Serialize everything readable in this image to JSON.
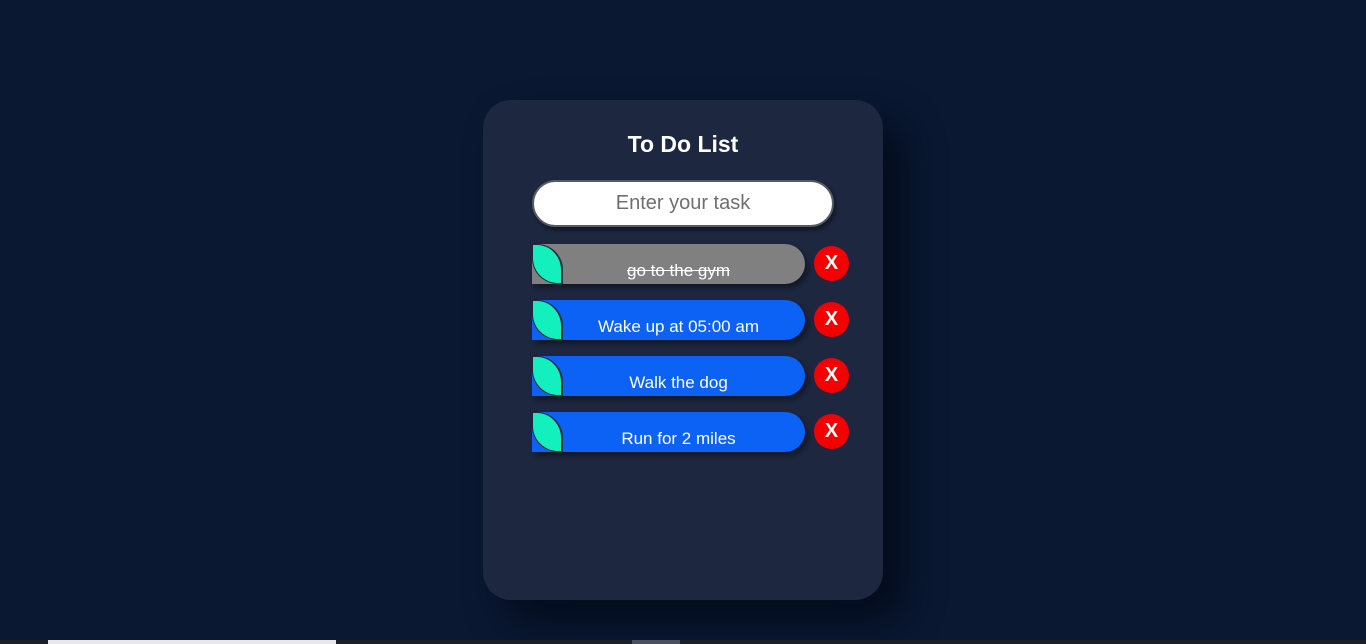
{
  "app": {
    "title": "To Do List"
  },
  "input": {
    "placeholder": "Enter your task",
    "value": ""
  },
  "tasks": [
    {
      "text": "go to the gym",
      "completed": true
    },
    {
      "text": "Wake up at 05:00 am",
      "completed": false
    },
    {
      "text": "Walk the dog",
      "completed": false
    },
    {
      "text": "Run for 2 miles",
      "completed": false
    }
  ],
  "delete_label": "X",
  "colors": {
    "background": "#0a1832",
    "card": "#1e2740",
    "task_pending": "#0b62f5",
    "task_done": "#808080",
    "check_marker": "#13f0bd",
    "delete_button": "#f40000"
  },
  "icons": {
    "check_marker": "leaf-check-icon",
    "delete": "close-icon"
  }
}
